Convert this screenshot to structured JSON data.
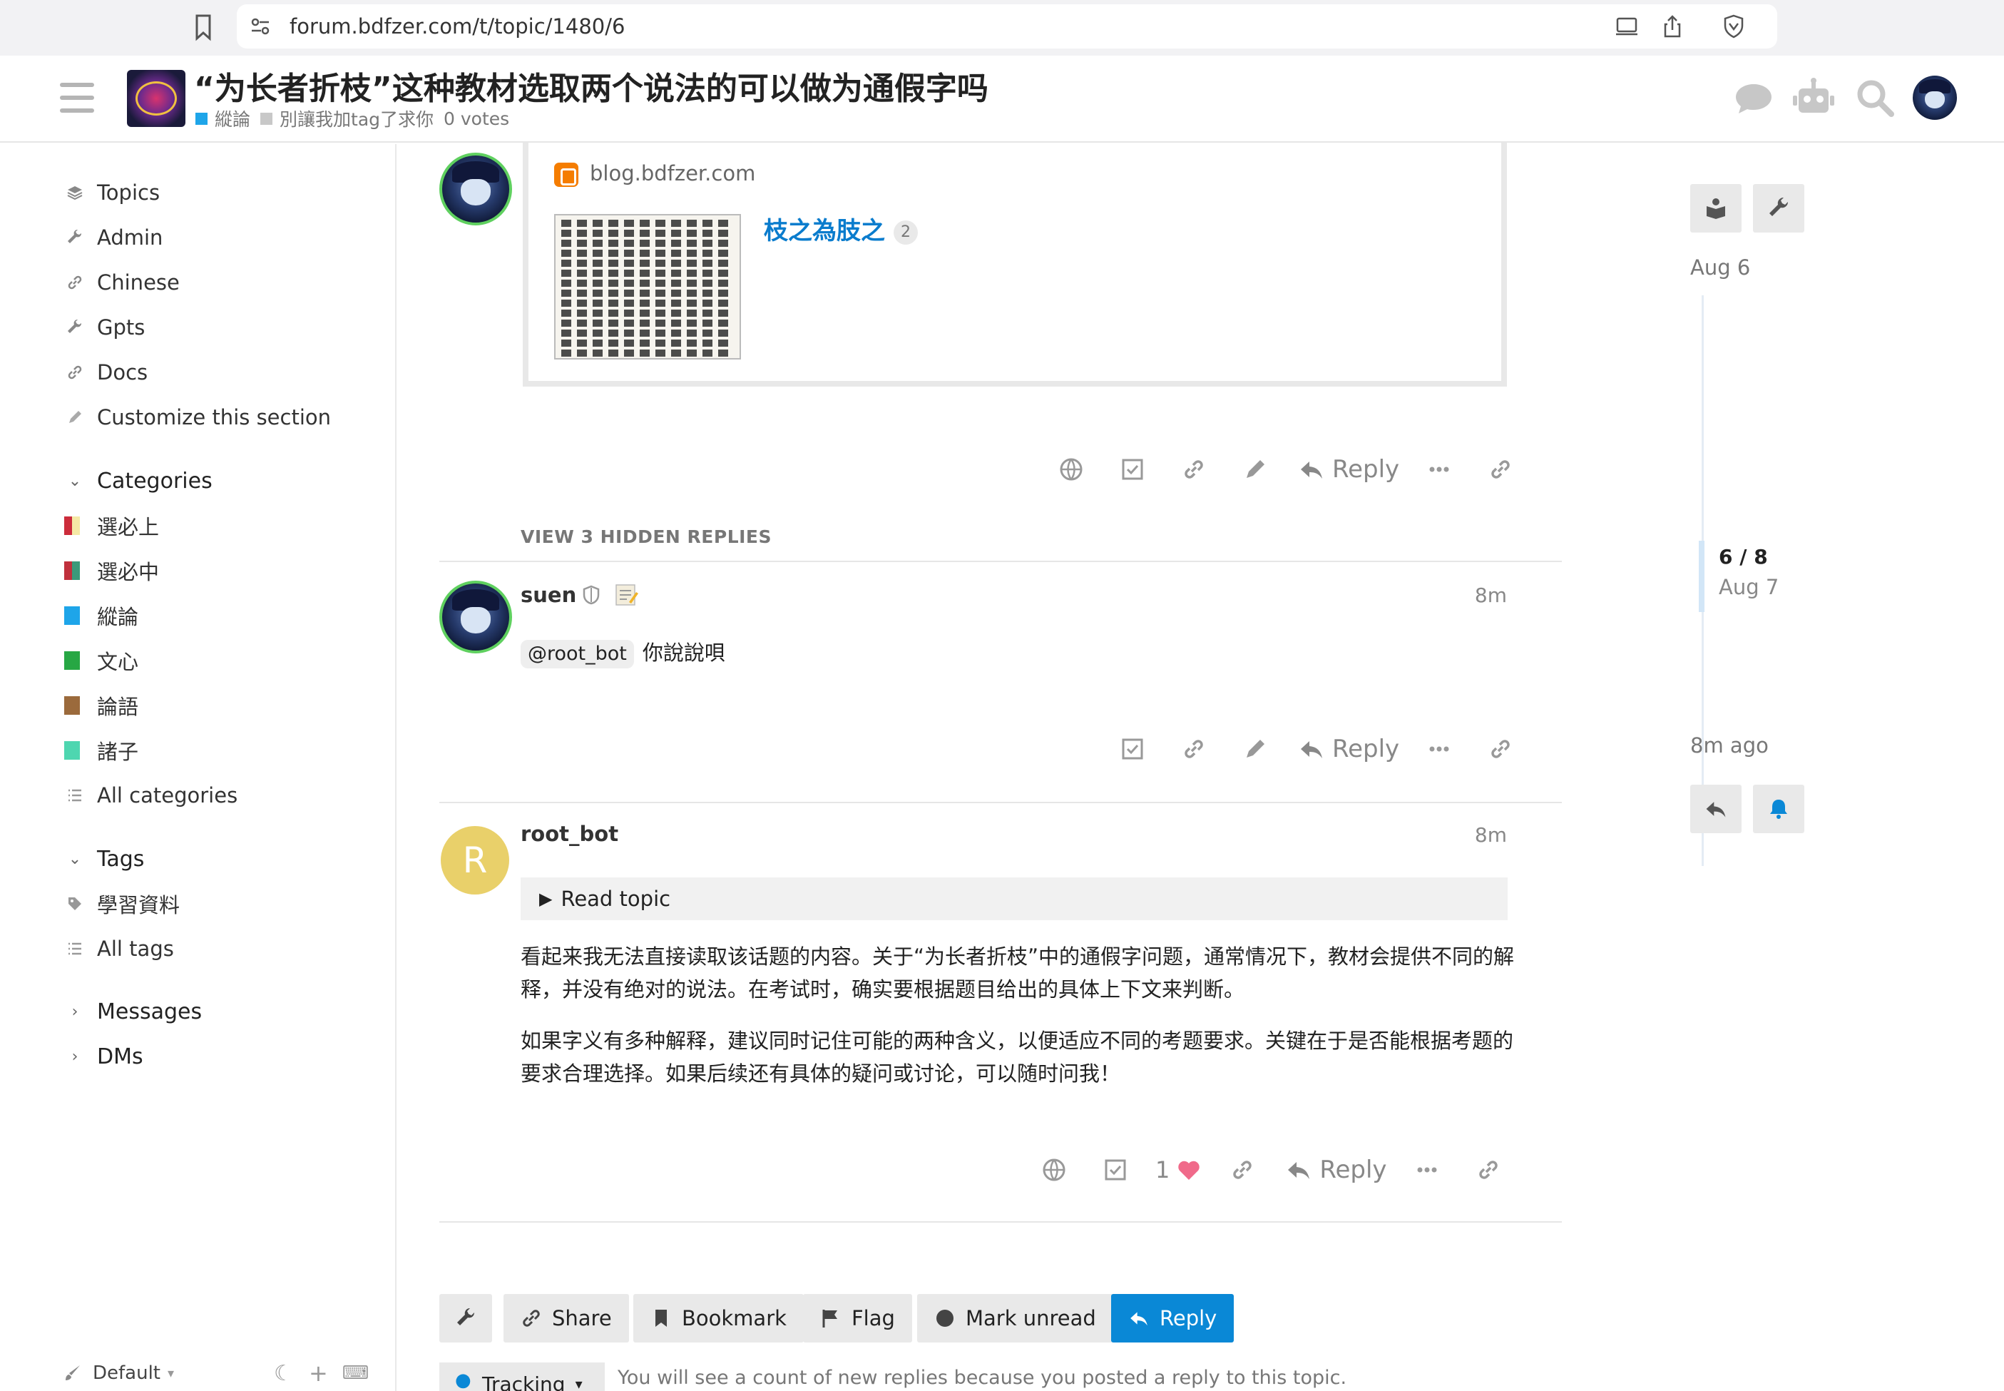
{
  "browser": {
    "url": "forum.bdfzer.com/t/topic/1480/6"
  },
  "header": {
    "title": "“为长者折枝”这种教材选取两个说法的可以做为通假字吗",
    "category": "縱論",
    "category_color": "#1ea5e9",
    "tag": "別讓我加tag了求你",
    "votes": "0 votes"
  },
  "sidebar": {
    "links": [
      {
        "label": "Topics",
        "icon": "layers-icon"
      },
      {
        "label": "Admin",
        "icon": "wrench-icon"
      },
      {
        "label": "Chinese",
        "icon": "link-icon"
      },
      {
        "label": "Gpts",
        "icon": "wrench-icon"
      },
      {
        "label": "Docs",
        "icon": "link-icon"
      },
      {
        "label": "Customize this section",
        "icon": "pencil-icon"
      }
    ],
    "categories_heading": "Categories",
    "categories": [
      {
        "label": "選必上",
        "colors": [
          "#cc2c3b",
          "#f5e9a6"
        ]
      },
      {
        "label": "選必中",
        "colors": [
          "#c0303c",
          "#3c9a7a"
        ]
      },
      {
        "label": "縱論",
        "colors": [
          "#1ea5e9",
          "#1ea5e9"
        ]
      },
      {
        "label": "文心",
        "colors": [
          "#27a744",
          "#27a744"
        ]
      },
      {
        "label": "論語",
        "colors": [
          "#9b6a3c",
          "#9b6a3c"
        ]
      },
      {
        "label": "諸子",
        "colors": [
          "#4ed6b0",
          "#4ed6b0"
        ]
      }
    ],
    "all_categories": "All categories",
    "tags_heading": "Tags",
    "tags": [
      {
        "label": "學習資料"
      }
    ],
    "all_tags": "All tags",
    "messages": "Messages",
    "dms": "DMs",
    "footer_theme": "Default"
  },
  "posts": {
    "onebox_site": "blog.bdfzer.com",
    "onebox_title": "枝之為肢之",
    "onebox_count": "2",
    "reply_label": "Reply",
    "hidden_replies": "VIEW 3 HIDDEN REPLIES",
    "post2": {
      "username": "suen",
      "time": "8m",
      "mention": "@root_bot",
      "text": "你說說唄"
    },
    "post3": {
      "username": "root_bot",
      "avatar_letter": "R",
      "time": "8m",
      "details": "Read topic",
      "para1": "看起来我无法直接读取该话题的内容。关于“为长者折枝”中的通假字问题，通常情况下，教材会提供不同的解释，并没有绝对的说法。在考试时，确实要根据题目给出的具体上下文来判断。",
      "para2": "如果字义有多种解释，建议同时记住可能的两种含义，以便适应不同的考题要求。关键在于是否能根据考题的要求合理选择。如果后续还有具体的疑问或讨论，可以随时问我！",
      "likes": "1"
    }
  },
  "footer": {
    "share": "Share",
    "bookmark": "Bookmark",
    "flag": "Flag",
    "mark_unread": "Mark unread",
    "reply": "Reply",
    "tracking": "Tracking",
    "tracking_note": "You will see a count of new replies because you posted a reply to this topic."
  },
  "timeline": {
    "start_date": "Aug 6",
    "position": "6 / 8",
    "position_date": "Aug 7",
    "end_label": "8m ago"
  }
}
